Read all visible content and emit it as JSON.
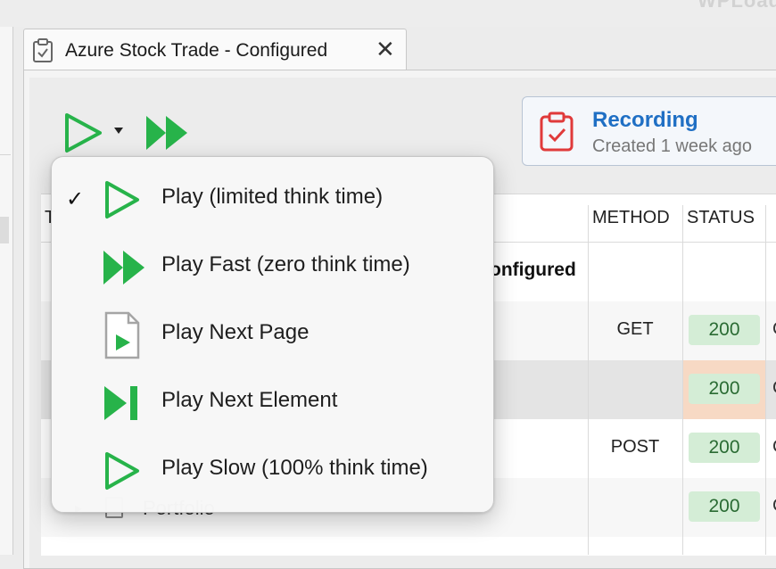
{
  "app": {
    "title": "WPLoad"
  },
  "tab": {
    "label": "Azure Stock Trade - Configured",
    "close_glyph": "✕"
  },
  "toolbar": {
    "play_icon": "play-outline-icon",
    "fast_icon": "fast-forward-icon",
    "accent": "#27b34a"
  },
  "recording": {
    "title": "Recording",
    "subtitle": "Created 1 week ago",
    "title_color": "#1f6fc4",
    "icon_color": "#e03a3a"
  },
  "table": {
    "headers": {
      "name_initial": "T",
      "method": "METHOD",
      "status": "STATUS"
    },
    "group_name_fragment": "onfigured",
    "rows": [
      {
        "method": "GET",
        "status": "200"
      },
      {
        "method": "",
        "status": "200"
      },
      {
        "method": "POST",
        "status": "200"
      },
      {
        "method": "",
        "status": "200"
      }
    ],
    "partial_row_text": "Portfolio",
    "next_col_fragment": "C"
  },
  "menu": {
    "items": [
      {
        "label": "Play (limited think time)",
        "checked": true,
        "icon": "play-outline-icon"
      },
      {
        "label": "Play Fast (zero think time)",
        "checked": false,
        "icon": "fast-forward-icon"
      },
      {
        "label": "Play Next Page",
        "checked": false,
        "icon": "page-play-icon"
      },
      {
        "label": "Play Next Element",
        "checked": false,
        "icon": "step-forward-icon"
      },
      {
        "label": "Play Slow (100% think time)",
        "checked": false,
        "icon": "play-outline-icon"
      }
    ],
    "check_glyph": "✓"
  }
}
